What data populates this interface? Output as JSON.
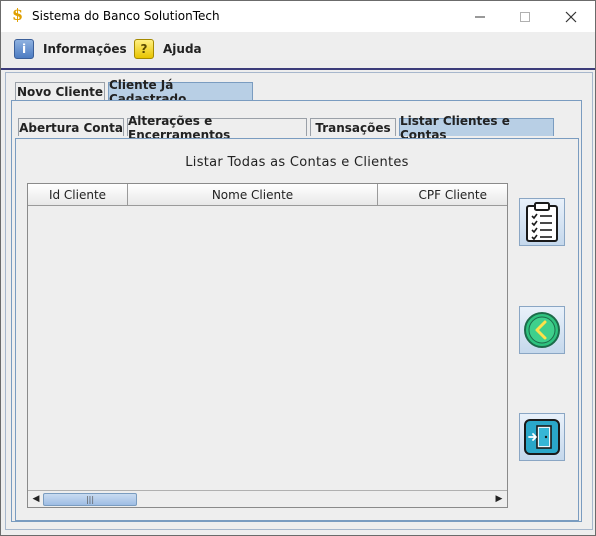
{
  "window": {
    "title": "Sistema do Banco SolutionTech",
    "app_icon": "dollar-icon",
    "controls": {
      "minimize": "—",
      "maximize": "☐",
      "close": "✕"
    }
  },
  "menu": {
    "items": [
      {
        "label": "Informações",
        "icon": "info-icon",
        "glyph": "i"
      },
      {
        "label": "Ajuda",
        "icon": "help-icon",
        "glyph": "?"
      }
    ]
  },
  "outer_tabs": [
    {
      "label": "Novo Cliente",
      "selected": false
    },
    {
      "label": "Cliente Já Cadastrado",
      "selected": true
    }
  ],
  "inner_tabs": [
    {
      "label": "Abertura Conta",
      "selected": false
    },
    {
      "label": "Alterações e Encerramentos",
      "selected": false
    },
    {
      "label": "Transações",
      "selected": false
    },
    {
      "label": "Listar Clientes e Contas",
      "selected": true
    }
  ],
  "panel": {
    "title": "Listar Todas as Contas e Clientes",
    "table": {
      "columns": [
        "Id Cliente",
        "Nome Cliente",
        "CPF Cliente"
      ],
      "rows": []
    },
    "scroll": {
      "left_arrow": "◀",
      "right_arrow": "▶",
      "grip": "|||"
    }
  },
  "side_buttons": [
    {
      "name": "list-button",
      "icon": "clipboard-checklist-icon"
    },
    {
      "name": "back-button",
      "icon": "chevron-left-icon"
    },
    {
      "name": "exit-button",
      "icon": "exit-door-icon"
    }
  ],
  "colors": {
    "selected_tab": "#b8cfe5",
    "accent_green": "#2ec27e",
    "accent_teal": "#2aa7c9"
  }
}
